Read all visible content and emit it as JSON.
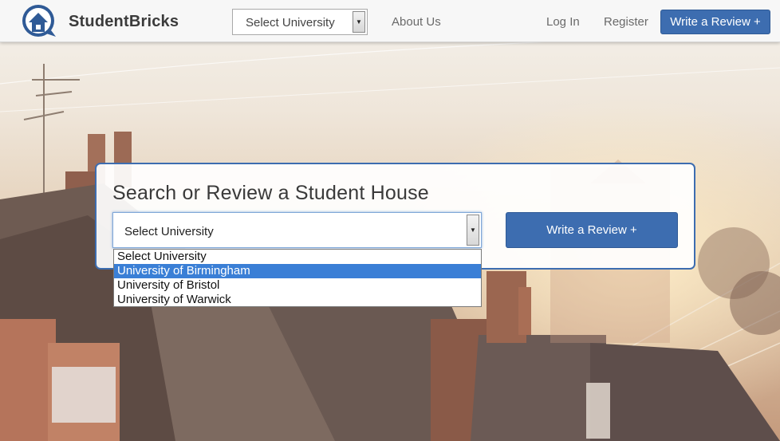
{
  "brand": {
    "name": "StudentBricks"
  },
  "nav": {
    "select_label": "Select University",
    "about": "About Us",
    "login": "Log In",
    "register": "Register",
    "cta": "Write a Review +"
  },
  "hero": {
    "title": "Search or Review a Student House",
    "select_label": "Select University",
    "cta": "Write a Review +",
    "dropdown_options": [
      {
        "label": "Select University",
        "selected": false
      },
      {
        "label": "University of Birmingham",
        "selected": true
      },
      {
        "label": "University of Bristol",
        "selected": false
      },
      {
        "label": "University of Warwick",
        "selected": false
      }
    ]
  },
  "colors": {
    "primary": "#3d6db0",
    "selected_option": "#3a7fd6",
    "brand_text": "#3b3b3b"
  },
  "icons": {
    "logo": "house-chat-icon",
    "select_arrow": "chevron-down-icon"
  }
}
